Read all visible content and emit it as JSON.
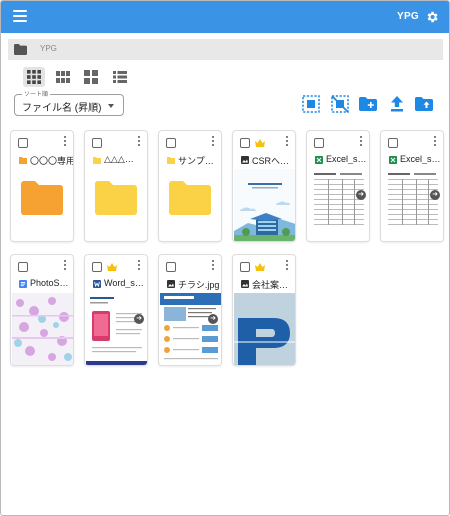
{
  "appbar": {
    "user": "YPG",
    "menu_icon": "menu-icon",
    "settings_icon": "gear-icon",
    "bg_color": "#3b93e6"
  },
  "breadcrumb": {
    "path": "YPG"
  },
  "view_modes": [
    "large-grid",
    "medium-grid",
    "small-grid",
    "list"
  ],
  "sort": {
    "label": "ソート順",
    "value": "ファイル名 (昇順)"
  },
  "toolbar": [
    "select-all-icon",
    "deselect-icon",
    "new-folder-icon",
    "upload-file-icon",
    "upload-folder-icon"
  ],
  "files": [
    {
      "name": "〇〇〇専用",
      "type": "folder",
      "folder_color": "#f6a233"
    },
    {
      "name": "△△△…",
      "type": "folder",
      "folder_color": "#fbd245"
    },
    {
      "name": "サンプ…",
      "type": "folder",
      "folder_color": "#fbd245"
    },
    {
      "name": "CSRへ…",
      "type": "image",
      "starred": true
    },
    {
      "name": "Excel_s…",
      "type": "excel"
    },
    {
      "name": "Excel_s…",
      "type": "excel"
    },
    {
      "name": "PhotoS…",
      "type": "doc"
    },
    {
      "name": "Word_s…",
      "type": "word",
      "starred": true
    },
    {
      "name": "チラシ.jpg",
      "type": "image"
    },
    {
      "name": "会社案…",
      "type": "image",
      "starred": true
    }
  ]
}
